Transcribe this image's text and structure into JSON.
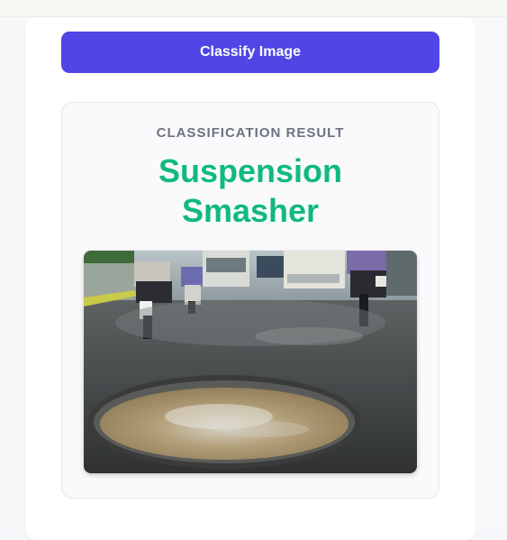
{
  "classify_button": {
    "label": "Classify Image"
  },
  "result": {
    "heading": "CLASSIFICATION RESULT",
    "name_line1": "Suspension",
    "name_line2": "Smasher",
    "image_subject": "flooded-pothole-road-photo"
  },
  "colors": {
    "button_bg": "#4f46e5",
    "result_text": "#10b981",
    "heading_text": "#6b7280"
  }
}
